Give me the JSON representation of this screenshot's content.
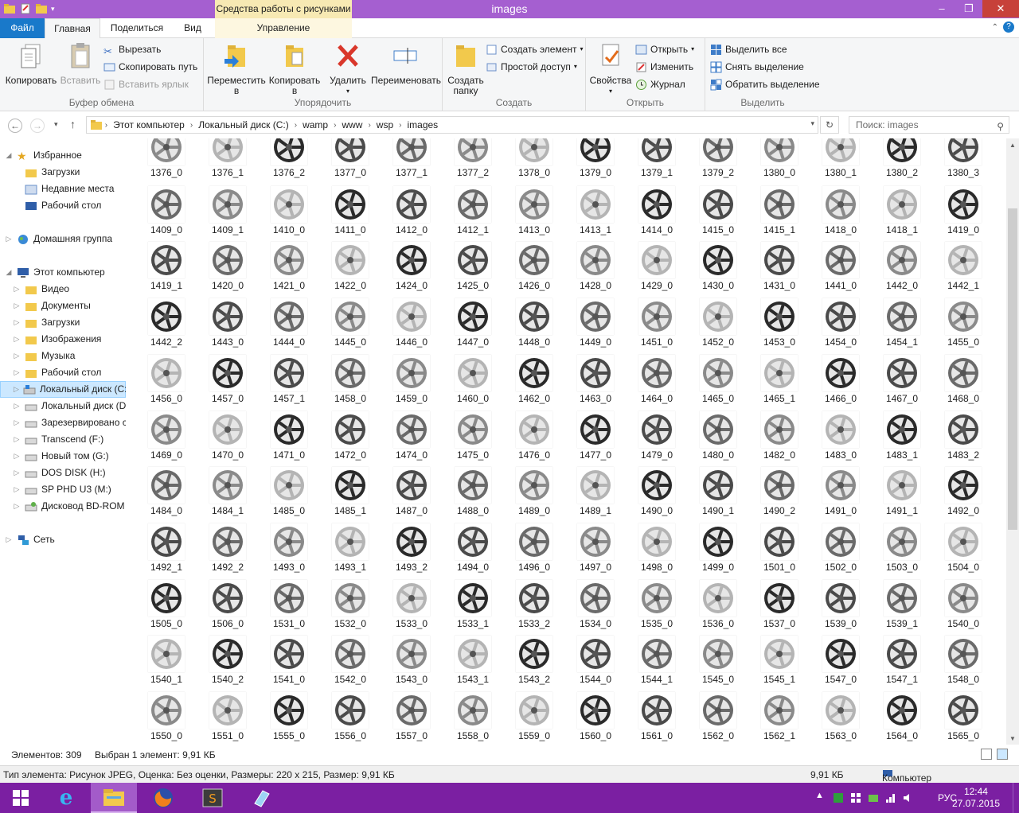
{
  "window": {
    "title": "images",
    "context_tab": "Средства работы с рисунками"
  },
  "tabs": {
    "file": "Файл",
    "home": "Главная",
    "share": "Поделиться",
    "view": "Вид",
    "manage": "Управление"
  },
  "ribbon": {
    "clipboard": {
      "label": "Буфер обмена",
      "copy": "Копировать",
      "paste": "Вставить",
      "cut": "Вырезать",
      "copy_path": "Скопировать путь",
      "paste_shortcut": "Вставить ярлык"
    },
    "organize": {
      "label": "Упорядочить",
      "move_to_1": "Переместить",
      "move_to_2": "в",
      "copy_to_1": "Копировать",
      "copy_to_2": "в",
      "delete": "Удалить",
      "rename": "Переименовать"
    },
    "create": {
      "label": "Создать",
      "new_folder_1": "Создать",
      "new_folder_2": "папку",
      "new_item": "Создать элемент",
      "easy_access": "Простой доступ"
    },
    "open": {
      "label": "Открыть",
      "properties": "Свойства",
      "open": "Открыть",
      "edit": "Изменить",
      "history": "Журнал"
    },
    "select": {
      "label": "Выделить",
      "select_all": "Выделить все",
      "select_none": "Снять выделение",
      "invert": "Обратить выделение"
    }
  },
  "address": {
    "crumbs": [
      "Этот компьютер",
      "Локальный диск (C:)",
      "wamp",
      "www",
      "wsp",
      "images"
    ],
    "search_placeholder": "Поиск: images"
  },
  "nav": {
    "favorites": "Избранное",
    "fav_items": [
      "Загрузки",
      "Недавние места",
      "Рабочий стол"
    ],
    "homegroup": "Домашняя группа",
    "this_pc": "Этот компьютер",
    "pc_items": [
      "Видео",
      "Документы",
      "Загрузки",
      "Изображения",
      "Музыка",
      "Рабочий стол",
      "Локальный диск (C:)",
      "Локальный диск (D:)",
      "Зарезервировано с",
      "Transcend (F:)",
      "Новый том (G:)",
      "DOS DISK (H:)",
      "SP PHD U3 (M:)",
      "Дисковод BD-ROM"
    ],
    "network": "Сеть"
  },
  "files": [
    [
      "1376_0",
      "1376_1",
      "1376_2",
      "1377_0",
      "1377_1",
      "1377_2",
      "1378_0",
      "1379_0",
      "1379_1",
      "1379_2",
      "1380_0",
      "1380_1",
      "1380_2",
      "1380_3"
    ],
    [
      "1409_0",
      "1409_1",
      "1410_0",
      "1411_0",
      "1412_0",
      "1412_1",
      "1413_0",
      "1413_1",
      "1414_0",
      "1415_0",
      "1415_1",
      "1418_0",
      "1418_1",
      "1419_0"
    ],
    [
      "1419_1",
      "1420_0",
      "1421_0",
      "1422_0",
      "1424_0",
      "1425_0",
      "1426_0",
      "1428_0",
      "1429_0",
      "1430_0",
      "1431_0",
      "1441_0",
      "1442_0",
      "1442_1"
    ],
    [
      "1442_2",
      "1443_0",
      "1444_0",
      "1445_0",
      "1446_0",
      "1447_0",
      "1448_0",
      "1449_0",
      "1451_0",
      "1452_0",
      "1453_0",
      "1454_0",
      "1454_1",
      "1455_0"
    ],
    [
      "1456_0",
      "1457_0",
      "1457_1",
      "1458_0",
      "1459_0",
      "1460_0",
      "1462_0",
      "1463_0",
      "1464_0",
      "1465_0",
      "1465_1",
      "1466_0",
      "1467_0",
      "1468_0"
    ],
    [
      "1469_0",
      "1470_0",
      "1471_0",
      "1472_0",
      "1474_0",
      "1475_0",
      "1476_0",
      "1477_0",
      "1479_0",
      "1480_0",
      "1482_0",
      "1483_0",
      "1483_1",
      "1483_2"
    ],
    [
      "1484_0",
      "1484_1",
      "1485_0",
      "1485_1",
      "1487_0",
      "1488_0",
      "1489_0",
      "1489_1",
      "1490_0",
      "1490_1",
      "1490_2",
      "1491_0",
      "1491_1",
      "1492_0"
    ],
    [
      "1492_1",
      "1492_2",
      "1493_0",
      "1493_1",
      "1493_2",
      "1494_0",
      "1496_0",
      "1497_0",
      "1498_0",
      "1499_0",
      "1501_0",
      "1502_0",
      "1503_0",
      "1504_0"
    ],
    [
      "1505_0",
      "1506_0",
      "1531_0",
      "1532_0",
      "1533_0",
      "1533_1",
      "1533_2",
      "1534_0",
      "1535_0",
      "1536_0",
      "1537_0",
      "1539_0",
      "1539_1",
      "1540_0"
    ],
    [
      "1540_1",
      "1540_2",
      "1541_0",
      "1542_0",
      "1543_0",
      "1543_1",
      "1543_2",
      "1544_0",
      "1544_1",
      "1545_0",
      "1545_1",
      "1547_0",
      "1547_1",
      "1548_0"
    ],
    [
      "1550_0",
      "1551_0",
      "1555_0",
      "1556_0",
      "1557_0",
      "1558_0",
      "1559_0",
      "1560_0",
      "1561_0",
      "1562_0",
      "1562_1",
      "1563_0",
      "1564_0",
      "1565_0"
    ]
  ],
  "status": {
    "count": "Элементов: 309",
    "selected": "Выбран 1 элемент: 9,91 КБ"
  },
  "details": {
    "info": "Тип элемента: Рисунок JPEG, Оценка: Без оценки, Размеры: 220 x 215, Размер: 9,91 КБ",
    "size": "9,91 КБ",
    "location": "Компьютер"
  },
  "taskbar": {
    "lang": "РУС",
    "time": "12:44",
    "date": "27.07.2015"
  },
  "colors": {
    "accent": "#a55fd0",
    "taskbar": "#7b1fa2",
    "file_tab": "#1979ca"
  }
}
